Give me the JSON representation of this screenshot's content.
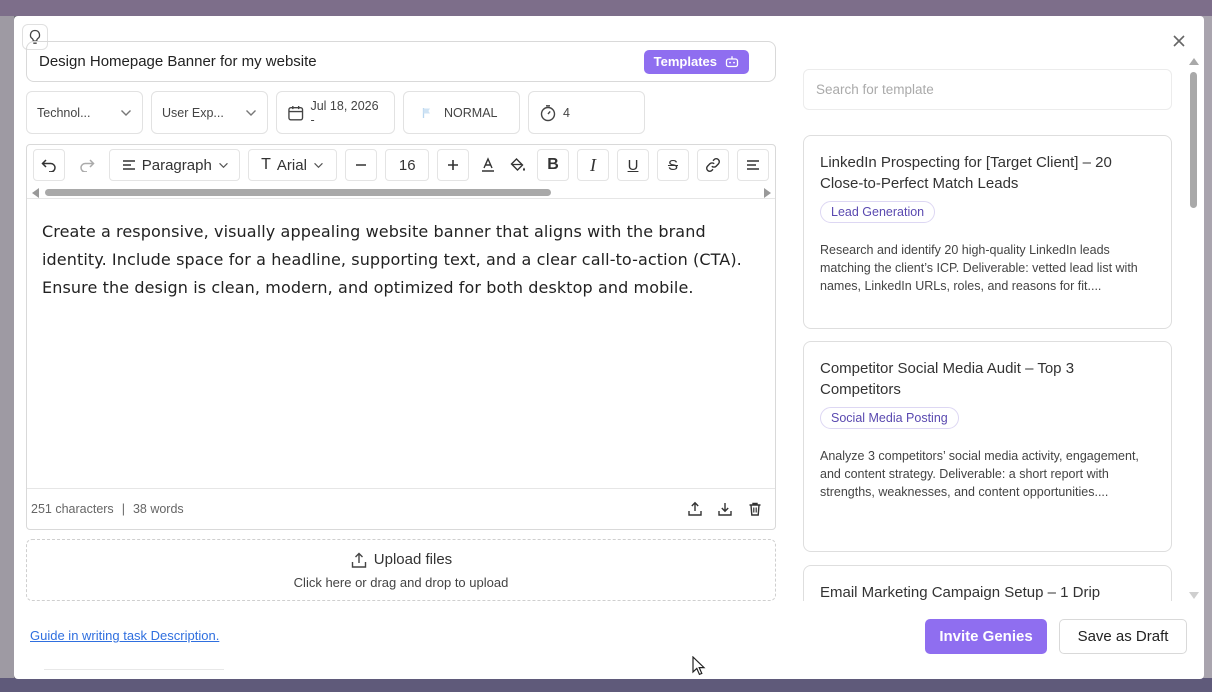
{
  "task": {
    "title": "Design Homepage Banner for my website",
    "templates_label": "Templates"
  },
  "meta": {
    "category": "Technol...",
    "subcategory": "User Exp...",
    "date": "Jul 18, 2026 -",
    "priority": "NORMAL",
    "hours": "4"
  },
  "toolbar": {
    "block_type": "Paragraph",
    "font": "Arial",
    "font_size": "16"
  },
  "editor": {
    "body": "Create a responsive, visually appealing website banner that aligns with the brand identity. Include space for a headline, supporting text, and a clear call-to-action (CTA). Ensure the design is clean, modern, and optimized for both desktop and mobile.",
    "char_count": "251 characters",
    "separator": "|",
    "word_count": "38 words"
  },
  "upload": {
    "title": "Upload files",
    "subtitle": "Click here or drag and drop to upload"
  },
  "footer": {
    "guide_link": "Guide in writing task Description.",
    "invite_label": "Invite Genies",
    "draft_label": "Save as Draft"
  },
  "templates_panel": {
    "search_placeholder": "Search for template",
    "cards": [
      {
        "title": "LinkedIn Prospecting for [Target Client] – 20 Close-to-Perfect Match Leads",
        "tag": "Lead Generation",
        "description": "Research and identify 20 high-quality LinkedIn leads matching the client’s ICP. Deliverable: vetted lead list with names, LinkedIn URLs, roles, and reasons for fit...."
      },
      {
        "title": "Competitor Social Media Audit – Top 3 Competitors",
        "tag": "Social Media Posting",
        "description": "Analyze 3 competitors’ social media activity, engagement, and content strategy. Deliverable: a short report with strengths, weaknesses, and content opportunities...."
      },
      {
        "title": "Email Marketing Campaign Setup – 1 Drip",
        "tag": "",
        "description": ""
      }
    ]
  },
  "colors": {
    "accent": "#8f6ef0",
    "link": "#2f6fdf",
    "tag_text": "#5a49b0"
  }
}
